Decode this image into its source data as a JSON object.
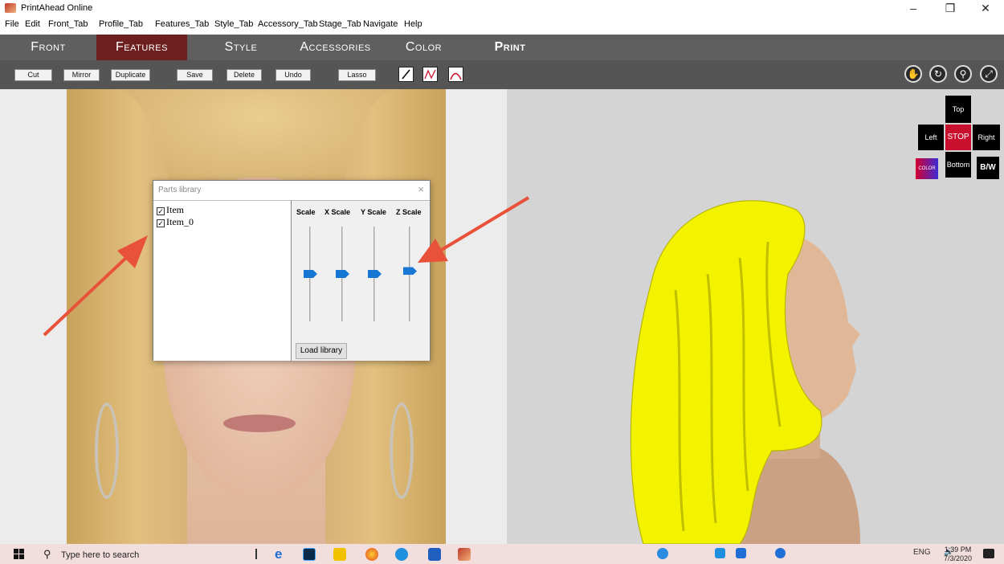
{
  "window": {
    "title": "PrintAhead Online",
    "controls": {
      "minimize": "–",
      "restore": "❐",
      "close": "✕"
    }
  },
  "menu": [
    "File",
    "Edit",
    "Front_Tab",
    "Profile_Tab",
    "Features_Tab",
    "Style_Tab",
    "Accessory_Tab",
    "Stage_Tab",
    "Navigate",
    "Help"
  ],
  "tabs": [
    {
      "label": "Front",
      "active": false
    },
    {
      "label": "Features",
      "active": true
    },
    {
      "label": "Style",
      "active": false
    },
    {
      "label": "Accessories",
      "active": false
    },
    {
      "label": "Color",
      "active": false
    },
    {
      "label": "Print",
      "active": false
    }
  ],
  "toolbar": {
    "buttons": [
      "Cut",
      "Mirror",
      "Duplicate",
      "Save",
      "Delete",
      "Undo",
      "Lasso"
    ],
    "draw_tools": [
      "line-draw-icon",
      "curve-draw-icon",
      "arc-draw-icon"
    ],
    "nav_tools": [
      "pan-hand-icon",
      "rotate-icon",
      "zoom-icon",
      "fit-view-icon"
    ]
  },
  "parts_dialog": {
    "title": "Parts library",
    "close": "×",
    "items": [
      {
        "label": "Item",
        "checked": true
      },
      {
        "label": "Item_0",
        "checked": true
      }
    ],
    "sliders": [
      {
        "label": "Scale",
        "value": 0.5
      },
      {
        "label": "X Scale",
        "value": 0.5
      },
      {
        "label": "Y Scale",
        "value": 0.5
      },
      {
        "label": "Z Scale",
        "value": 0.53
      }
    ],
    "load_button": "Load library"
  },
  "view_controls": {
    "top": "Top",
    "left": "Left",
    "stop": "STOP",
    "right": "Right",
    "color": "COLOR",
    "bottom": "Bottom",
    "bw": "B/W"
  },
  "taskbar": {
    "search_placeholder": "Type here to search",
    "language": "ENG",
    "time": "1:39 PM",
    "date": "7/3/2020"
  },
  "colors": {
    "active_tab": "#6d1f1f",
    "tabbar": "#5f5f5f",
    "toolbar": "#555555",
    "slider_thumb": "#1677d4",
    "stop_button": "#c8102e",
    "hair_3d": "#f3f300",
    "arrow": "#e8513a"
  }
}
